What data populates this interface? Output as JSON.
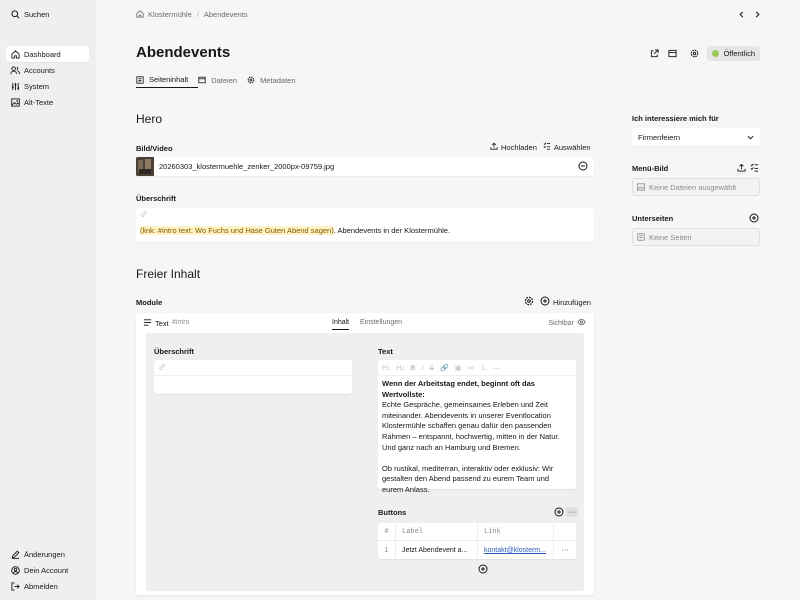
{
  "sidebar": {
    "search_label": "Suchen",
    "menu": [
      {
        "label": "Dashboard",
        "icon": "dashboard-icon"
      },
      {
        "label": "Accounts",
        "icon": "users-icon"
      },
      {
        "label": "System",
        "icon": "settings-icon"
      },
      {
        "label": "Alt-Texte",
        "icon": "image-icon"
      }
    ],
    "bottom": [
      {
        "label": "Änderungen",
        "icon": "edit-icon"
      },
      {
        "label": "Dein Account",
        "icon": "account-icon"
      },
      {
        "label": "Abmelden",
        "icon": "logout-icon"
      }
    ]
  },
  "breadcrumb": {
    "site": "Klostermühle",
    "page": "Abendevents"
  },
  "page": {
    "title": "Abendevents",
    "status": "Öffentlich",
    "status_color": "#9bc857",
    "tabs": [
      {
        "label": "Seiteninhalt",
        "icon": "page-icon"
      },
      {
        "label": "Dateien",
        "icon": "folder-icon"
      },
      {
        "label": "Metadaten",
        "icon": "gear-icon"
      }
    ]
  },
  "hero": {
    "heading": "Hero",
    "media_label": "Bild/Video",
    "upload_label": "Hochladen",
    "select_label": "Auswählen",
    "file_name": "20260303_klostermuehle_zenker_2000px-09759.jpg",
    "headline_label": "Überschrift",
    "headline_link": "(link: #intro text: Wo Fuchs und Hase Guten Abend sagen)",
    "headline_rest": ". Abendevents in der Klostermühle."
  },
  "free": {
    "heading": "Freier Inhalt",
    "modules_label": "Module",
    "add_label": "Hinzufügen",
    "block": {
      "type": "Text",
      "anchor": "#intro",
      "tab_content": "Inhalt",
      "tab_settings": "Einstellungen",
      "visible_label": "Sichtbar",
      "headline_label": "Überschrift",
      "text_label": "Text",
      "toolbar": [
        "H₁",
        "H₂",
        "B",
        "I",
        "S",
        "🔗",
        "▣",
        "≔",
        "⒈",
        "—"
      ],
      "text_bold": "Wenn der Arbeitstag endet, beginnt oft das Wertvollste:",
      "text_p1": "Echte Gespräche, gemeinsames Erleben und Zeit miteinander. Abendevents in unserer Eventlocation Klostermühle schaffen genau dafür den passenden Rahmen – entspannt, hochwertig, mitten in der Natur. Und ganz nach an Hamburg und Bremen.",
      "text_p2": "Ob rustikal, mediterran, interaktiv oder exklusiv: Wir gestalten den Abend passend zu eurem Team und eurem Anlass.",
      "buttons_label": "Buttons",
      "table_headers": [
        "#",
        "Label",
        "Link"
      ],
      "rows": [
        {
          "index": "1",
          "label": "Jetzt Abendevent a...",
          "link": "kontakt@klosterm..."
        }
      ]
    }
  },
  "right": {
    "interest_label": "Ich interessiere mich für",
    "interest_value": "Firmenfeiern",
    "menu_image_label": "Menü-Bild",
    "menu_image_empty": "Keine Dateien ausgewählt",
    "subpages_label": "Unterseiten",
    "subpages_empty": "Keine Seiten"
  }
}
